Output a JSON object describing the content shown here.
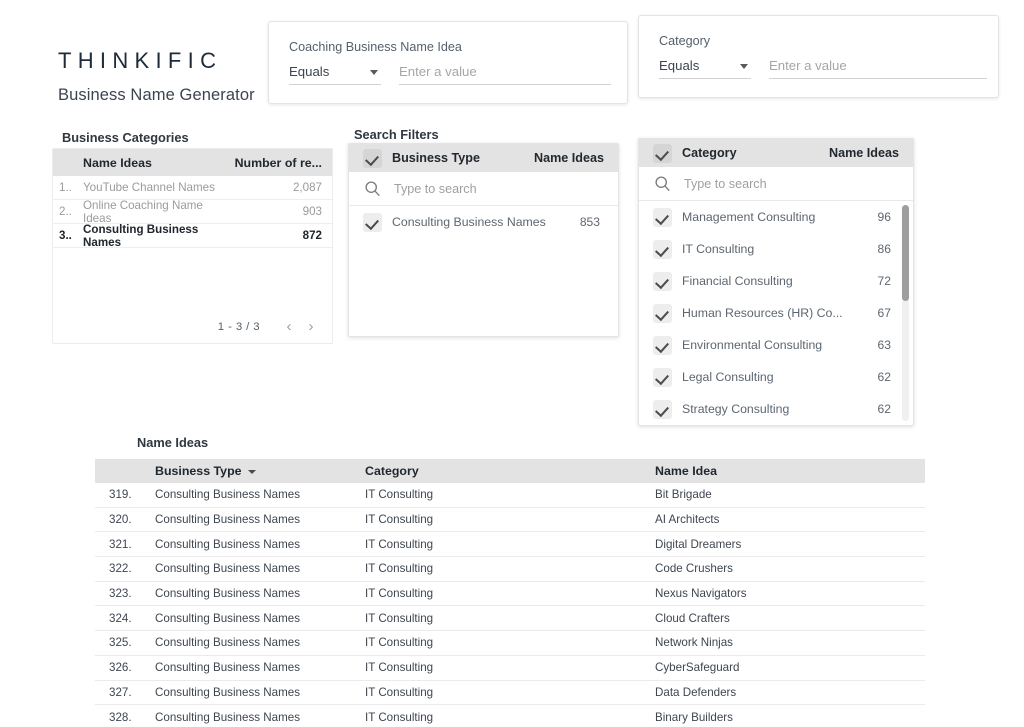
{
  "brand": {
    "logo": "THINKIFIC",
    "subtitle": "Business Name Generator"
  },
  "top_filters": [
    {
      "label": "Coaching Business Name Idea",
      "operator": "Equals",
      "value": "",
      "placeholder": "Enter a value"
    },
    {
      "label": "Category",
      "operator": "Equals",
      "value": "",
      "placeholder": "Enter a value"
    }
  ],
  "business_categories": {
    "title": "Business Categories",
    "columns": [
      "Name Ideas",
      "Number of re..."
    ],
    "rows": [
      {
        "num": "1..",
        "name": "YouTube Channel Names",
        "value": "2,087",
        "selected": false
      },
      {
        "num": "2..",
        "name": "Online Coaching Name Ideas",
        "value": "903",
        "selected": false
      },
      {
        "num": "3..",
        "name": "Consulting Business Names",
        "value": "872",
        "selected": true
      }
    ],
    "pager": {
      "range": "1 - 3 / 3",
      "prev": "‹",
      "next": "›"
    }
  },
  "search_filters": {
    "title": "Search Filters",
    "business_type_panel": {
      "header_title": "Business Type",
      "header_metric": "Name Ideas",
      "search_placeholder": "Type to search",
      "items": [
        {
          "label": "Consulting Business Names",
          "count": "853",
          "checked": true
        }
      ]
    },
    "category_panel": {
      "header_title": "Category",
      "header_metric": "Name Ideas",
      "search_placeholder": "Type to search",
      "items": [
        {
          "label": "Management Consulting",
          "count": "96",
          "checked": true
        },
        {
          "label": "IT Consulting",
          "count": "86",
          "checked": true
        },
        {
          "label": "Financial Consulting",
          "count": "72",
          "checked": true
        },
        {
          "label": "Human Resources (HR) Co...",
          "count": "67",
          "checked": true
        },
        {
          "label": "Environmental Consulting",
          "count": "63",
          "checked": true
        },
        {
          "label": "Legal Consulting",
          "count": "62",
          "checked": true
        },
        {
          "label": "Strategy Consulting",
          "count": "62",
          "checked": true
        }
      ]
    }
  },
  "name_ideas_table": {
    "title": "Name Ideas",
    "columns": {
      "num": "",
      "business_type": "Business Type",
      "category": "Category",
      "name_idea": "Name Idea"
    },
    "sorted_column": "Business Type",
    "rows": [
      {
        "num": "319.",
        "business_type": "Consulting Business Names",
        "category": "IT Consulting",
        "name_idea": "Bit Brigade"
      },
      {
        "num": "320.",
        "business_type": "Consulting Business Names",
        "category": "IT Consulting",
        "name_idea": "AI Architects"
      },
      {
        "num": "321.",
        "business_type": "Consulting Business Names",
        "category": "IT Consulting",
        "name_idea": "Digital Dreamers"
      },
      {
        "num": "322.",
        "business_type": "Consulting Business Names",
        "category": "IT Consulting",
        "name_idea": "Code Crushers"
      },
      {
        "num": "323.",
        "business_type": "Consulting Business Names",
        "category": "IT Consulting",
        "name_idea": "Nexus Navigators"
      },
      {
        "num": "324.",
        "business_type": "Consulting Business Names",
        "category": "IT Consulting",
        "name_idea": "Cloud Crafters"
      },
      {
        "num": "325.",
        "business_type": "Consulting Business Names",
        "category": "IT Consulting",
        "name_idea": "Network Ninjas"
      },
      {
        "num": "326.",
        "business_type": "Consulting Business Names",
        "category": "IT Consulting",
        "name_idea": "CyberSafeguard"
      },
      {
        "num": "327.",
        "business_type": "Consulting Business Names",
        "category": "IT Consulting",
        "name_idea": "Data Defenders"
      },
      {
        "num": "328.",
        "business_type": "Consulting Business Names",
        "category": "IT Consulting",
        "name_idea": "Binary Builders"
      }
    ]
  },
  "colors": {
    "brand": "#1d2b3a",
    "header_bg": "#e3e3e3",
    "text": "#3f4650",
    "muted": "#9b9b9b"
  }
}
